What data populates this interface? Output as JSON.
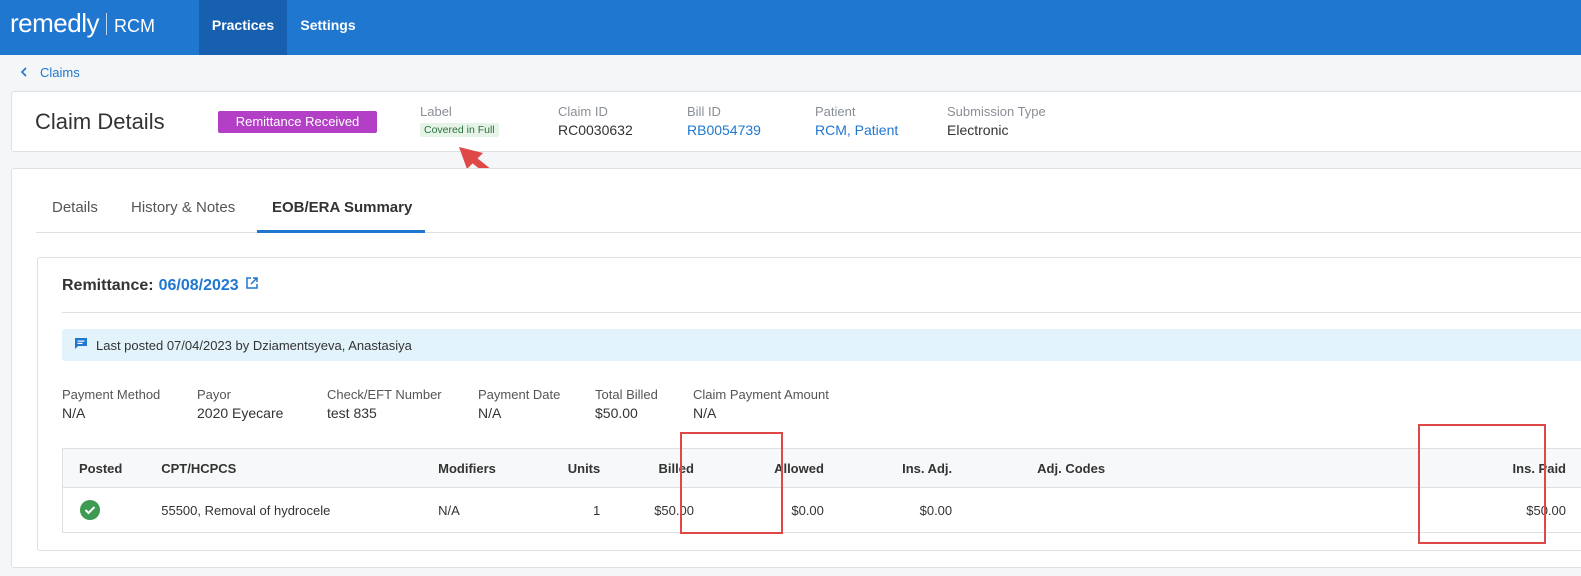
{
  "nav": {
    "logo": "remedly",
    "product": "RCM",
    "tabs": [
      {
        "label": "Practices",
        "active": true
      },
      {
        "label": "Settings",
        "active": false
      }
    ]
  },
  "breadcrumb": {
    "back_label": "Claims"
  },
  "claim": {
    "title": "Claim Details",
    "status": "Remittance Received",
    "status_color": "#b33fc6",
    "label_title": "Label",
    "label_value": "Covered in Full",
    "claim_id_label": "Claim ID",
    "claim_id": "RC0030632",
    "bill_id_label": "Bill ID",
    "bill_id": "RB0054739",
    "patient_label": "Patient",
    "patient": "RCM, Patient",
    "submission_label": "Submission Type",
    "submission": "Electronic"
  },
  "tabs": [
    {
      "label": "Details",
      "active": false
    },
    {
      "label": "History & Notes",
      "active": false
    },
    {
      "label": "EOB/ERA Summary",
      "active": true
    }
  ],
  "remittance": {
    "label": "Remittance:",
    "date": "06/08/2023",
    "last_posted": "Last posted 07/04/2023 by Dziamentsyeva, Anastasiya",
    "payment": {
      "method_label": "Payment Method",
      "method": "N/A",
      "payor_label": "Payor",
      "payor": "2020 Eyecare",
      "check_label": "Check/EFT Number",
      "check": "test 835",
      "date_label": "Payment Date",
      "date": "N/A",
      "total_label": "Total Billed",
      "total": "$50.00",
      "claim_amount_label": "Claim Payment Amount",
      "claim_amount": "N/A"
    },
    "table": {
      "headers": [
        "Posted",
        "CPT/HCPCS",
        "Modifiers",
        "Units",
        "Billed",
        "Allowed",
        "Ins. Adj.",
        "Adj. Codes",
        "Ins. Paid"
      ],
      "rows": [
        {
          "posted": true,
          "cpt": "55500, Removal of hydrocele",
          "modifiers": "N/A",
          "units": "1",
          "billed": "$50.00",
          "allowed": "$0.00",
          "ins_adj": "$0.00",
          "adj_codes": "",
          "ins_paid": "$50.00"
        }
      ]
    }
  },
  "colors": {
    "primary": "#1f77d0",
    "highlight": "#e04848",
    "posted": "#3d9a50"
  }
}
